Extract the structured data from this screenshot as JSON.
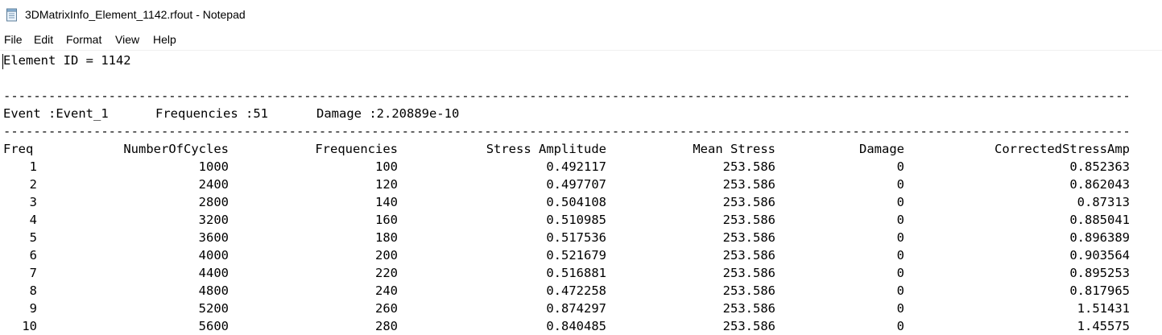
{
  "window": {
    "title": "3DMatrixInfo_Element_1142.rfout - Notepad"
  },
  "menu": [
    "File",
    "Edit",
    "Format",
    "View",
    "Help"
  ],
  "document": {
    "element_line": "Element ID = 1142",
    "separator": "------------------------------------------------------------------------------------------------------------------------------------------------------------------------------",
    "event_label": "Event :Event_1",
    "frequencies_label": "Frequencies :51",
    "damage_label": "Damage :2.20889e-10",
    "columns": [
      "Freq",
      "NumberOfCycles",
      "Frequencies",
      "Stress Amplitude",
      "Mean Stress",
      "Damage",
      "CorrectedStressAmp"
    ],
    "rows": [
      [
        "1",
        "1000",
        "100",
        "0.492117",
        "253.586",
        "0",
        "0.852363"
      ],
      [
        "2",
        "2400",
        "120",
        "0.497707",
        "253.586",
        "0",
        "0.862043"
      ],
      [
        "3",
        "2800",
        "140",
        "0.504108",
        "253.586",
        "0",
        "0.87313"
      ],
      [
        "4",
        "3200",
        "160",
        "0.510985",
        "253.586",
        "0",
        "0.885041"
      ],
      [
        "5",
        "3600",
        "180",
        "0.517536",
        "253.586",
        "0",
        "0.896389"
      ],
      [
        "6",
        "4000",
        "200",
        "0.521679",
        "253.586",
        "0",
        "0.903564"
      ],
      [
        "7",
        "4400",
        "220",
        "0.516881",
        "253.586",
        "0",
        "0.895253"
      ],
      [
        "8",
        "4800",
        "240",
        "0.472258",
        "253.586",
        "0",
        "0.817965"
      ],
      [
        "9",
        "5200",
        "260",
        "0.874297",
        "253.586",
        "0",
        "1.51431"
      ],
      [
        "10",
        "5600",
        "280",
        "0.840485",
        "253.586",
        "0",
        "1.45575"
      ]
    ]
  }
}
